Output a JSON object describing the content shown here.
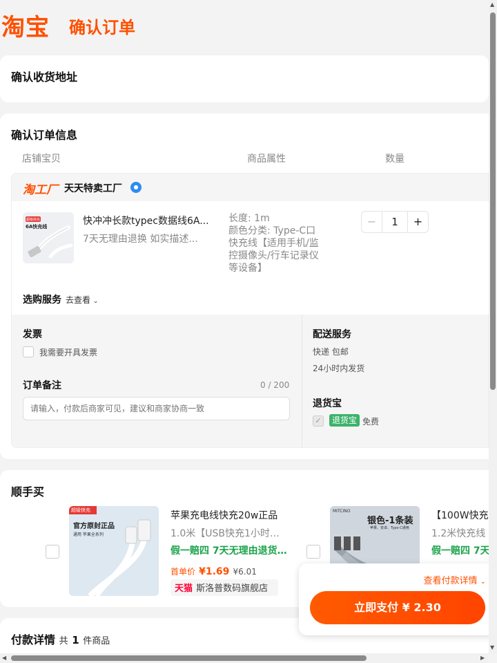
{
  "header": {
    "logo": "淘宝",
    "title": "确认订单"
  },
  "address": {
    "title": "确认收货地址"
  },
  "order": {
    "title": "确认订单信息",
    "columns": [
      "店铺宝贝",
      "商品属性",
      "数量"
    ],
    "shop": {
      "brand": "淘工厂",
      "name": "天天特卖工厂"
    },
    "item": {
      "thumb_badge": "超级快充",
      "thumb_text": "6A快充线",
      "title": "快冲冲长款typec数据线6A...",
      "sub": "7天无理由退换  如实描述...",
      "attr_length": "长度: 1m",
      "attr_color": "颜色分类: Type-C口快充线【适用手机/监控摄像头/行车记录仪等设备】",
      "qty": "1",
      "minus": "−",
      "plus": "+"
    },
    "service": {
      "label": "选购服务",
      "link": "去查看"
    },
    "invoice": {
      "title": "发票",
      "checkbox_label": "我需要开具发票"
    },
    "note": {
      "title": "订单备注",
      "counter": "0 / 200",
      "placeholder": "请输入，付款后商家可见，建议和商家协商一致"
    },
    "delivery": {
      "title": "配送服务",
      "method": "快递 包邮",
      "time": "24小时内发货"
    },
    "return": {
      "title": "退货宝",
      "badge": "退货宝",
      "free": "免费"
    }
  },
  "recommend": {
    "title": "顺手买",
    "items": [
      {
        "thumb_badge": "超级快充",
        "thumb_caption": "官方原封正品",
        "thumb_tags": "通用  苹果全系列",
        "title": "苹果充电线快充20w正品",
        "sub": "1.0米【USB快充1小时充...",
        "promo": "假一赔四  7天无理由退货...",
        "price_label": "首单价",
        "price": "¥1.69",
        "orig_price": "¥6.01",
        "store_tag": "天猫",
        "store": "斯洛普数码旗舰店"
      },
      {
        "thumb_brand": "MITCINO",
        "thumb_caption": "银色-1条装",
        "thumb_tags": "苹果、安卓、Type-C通用",
        "title": "【100W快充",
        "sub": "1.2米快充线",
        "promo": "假一赔四  7天"
      }
    ]
  },
  "payment": {
    "title": "付款详情",
    "count_prefix": "共",
    "count": "1",
    "count_suffix": "件商品",
    "detail_link": "查看付款详情",
    "pay_button": "立即支付 ¥ 2.30"
  },
  "colors": {
    "brand": "#ff5000",
    "green": "#1aa34a",
    "tmall": "#ff0036"
  }
}
